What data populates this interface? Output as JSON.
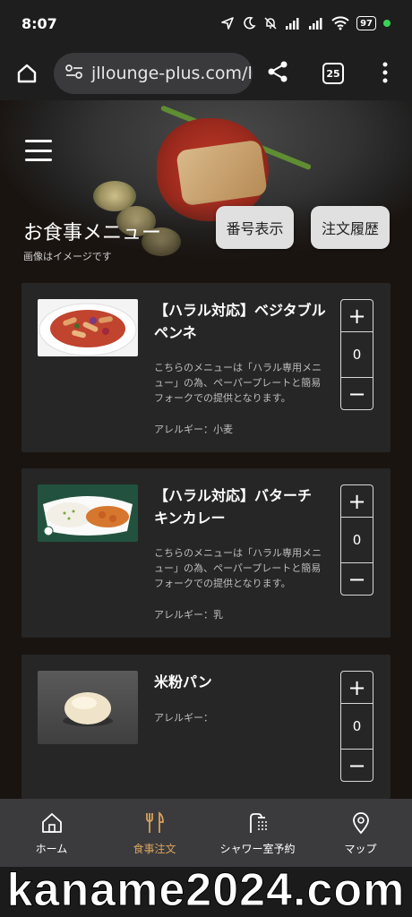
{
  "status_bar": {
    "time": "8:07",
    "battery": "97"
  },
  "browser": {
    "url": "jllounge-plus.com/l",
    "tab_count": "25"
  },
  "hero": {
    "title": "お食事メニュー",
    "note": "画像はイメージです",
    "number_button": "番号表示",
    "history_button": "注文履歴"
  },
  "menu_items": [
    {
      "name": "【ハラル対応】ベジタブルペンネ",
      "description": "こちらのメニューは「ハラル専用メニュー」の為、ペーパープレートと簡易フォークでの提供となります。",
      "allergy": "アレルギー：小麦",
      "quantity": "0"
    },
    {
      "name": "【ハラル対応】バターチキンカレー",
      "description": "こちらのメニューは「ハラル専用メニュー」の為、ペーパープレートと簡易フォークでの提供となります。",
      "allergy": "アレルギー：乳",
      "quantity": "0"
    },
    {
      "name": "米粉パン",
      "description": "",
      "allergy": "アレルギー：",
      "quantity": "0"
    }
  ],
  "stepper": {
    "plus": "+",
    "minus": "−"
  },
  "bottom_nav": [
    {
      "label": "ホーム",
      "icon": "home-icon"
    },
    {
      "label": "食事注文",
      "icon": "fork-knife-icon",
      "active": true
    },
    {
      "label": "シャワー室予約",
      "icon": "shower-icon"
    },
    {
      "label": "マップ",
      "icon": "map-pin-icon"
    }
  ],
  "watermark": "kaname2024.com",
  "colors": {
    "accent": "#d7a25c",
    "card": "#262626",
    "nav": "#3b3b3d"
  }
}
